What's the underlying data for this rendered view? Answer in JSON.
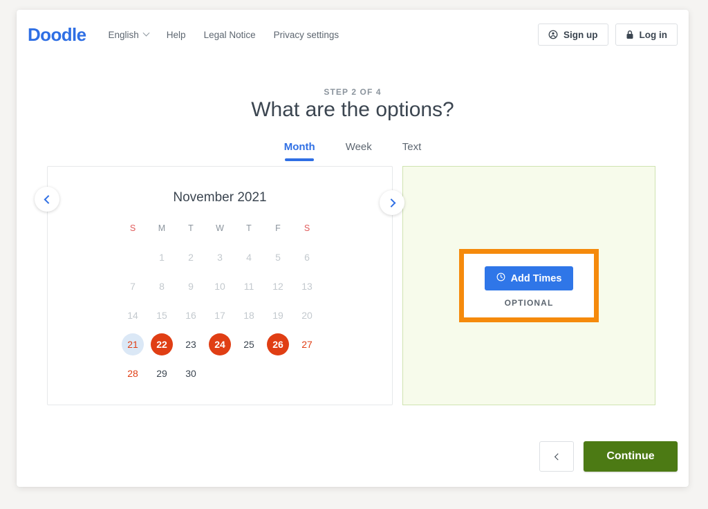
{
  "header": {
    "logo": "Doodle",
    "language": "English",
    "nav_links": [
      "Help",
      "Legal Notice",
      "Privacy settings"
    ],
    "sign_up_label": "Sign up",
    "log_in_label": "Log in"
  },
  "page": {
    "step_label": "STEP 2 OF 4",
    "title": "What are the options?"
  },
  "tabs": [
    {
      "label": "Month",
      "active": true
    },
    {
      "label": "Week",
      "active": false
    },
    {
      "label": "Text",
      "active": false
    }
  ],
  "calendar": {
    "month_title": "November 2021",
    "prev_label": "‹",
    "next_label": "›",
    "weekdays": [
      {
        "label": "S",
        "weekend": true
      },
      {
        "label": "M",
        "weekend": false
      },
      {
        "label": "T",
        "weekend": false
      },
      {
        "label": "W",
        "weekend": false
      },
      {
        "label": "T",
        "weekend": false
      },
      {
        "label": "F",
        "weekend": false
      },
      {
        "label": "S",
        "weekend": true
      }
    ],
    "weeks": [
      [
        {
          "day": "",
          "state": "empty"
        },
        {
          "day": "1",
          "state": "disabled"
        },
        {
          "day": "2",
          "state": "disabled"
        },
        {
          "day": "3",
          "state": "disabled"
        },
        {
          "day": "4",
          "state": "disabled"
        },
        {
          "day": "5",
          "state": "disabled"
        },
        {
          "day": "6",
          "state": "disabled"
        }
      ],
      [
        {
          "day": "7",
          "state": "disabled"
        },
        {
          "day": "8",
          "state": "disabled"
        },
        {
          "day": "9",
          "state": "disabled"
        },
        {
          "day": "10",
          "state": "disabled"
        },
        {
          "day": "11",
          "state": "disabled"
        },
        {
          "day": "12",
          "state": "disabled"
        },
        {
          "day": "13",
          "state": "disabled"
        }
      ],
      [
        {
          "day": "14",
          "state": "disabled"
        },
        {
          "day": "15",
          "state": "disabled"
        },
        {
          "day": "16",
          "state": "disabled"
        },
        {
          "day": "17",
          "state": "disabled"
        },
        {
          "day": "18",
          "state": "disabled"
        },
        {
          "day": "19",
          "state": "disabled"
        },
        {
          "day": "20",
          "state": "disabled"
        }
      ],
      [
        {
          "day": "21",
          "state": "today"
        },
        {
          "day": "22",
          "state": "selected"
        },
        {
          "day": "23",
          "state": "normal"
        },
        {
          "day": "24",
          "state": "selected"
        },
        {
          "day": "25",
          "state": "normal"
        },
        {
          "day": "26",
          "state": "selected"
        },
        {
          "day": "27",
          "state": "weekend"
        }
      ],
      [
        {
          "day": "28",
          "state": "weekend"
        },
        {
          "day": "29",
          "state": "normal"
        },
        {
          "day": "30",
          "state": "normal"
        },
        {
          "day": "",
          "state": "empty"
        },
        {
          "day": "",
          "state": "empty"
        },
        {
          "day": "",
          "state": "empty"
        },
        {
          "day": "",
          "state": "empty"
        }
      ]
    ],
    "selected_days": [
      "22",
      "24",
      "26"
    ],
    "today": "21"
  },
  "times_panel": {
    "add_times_label": "Add Times",
    "optional_label": "OPTIONAL",
    "highlight_color": "#f58a0c",
    "panel_background": "#f7fbeb"
  },
  "footer": {
    "back_label": "‹",
    "continue_label": "Continue",
    "continue_color": "#4c7a14"
  },
  "colors": {
    "brand_blue": "#2f6fe4",
    "selected_red": "#e03e14",
    "today_blue_bg": "#dbe8f6",
    "page_background": "#f5f4f2"
  }
}
